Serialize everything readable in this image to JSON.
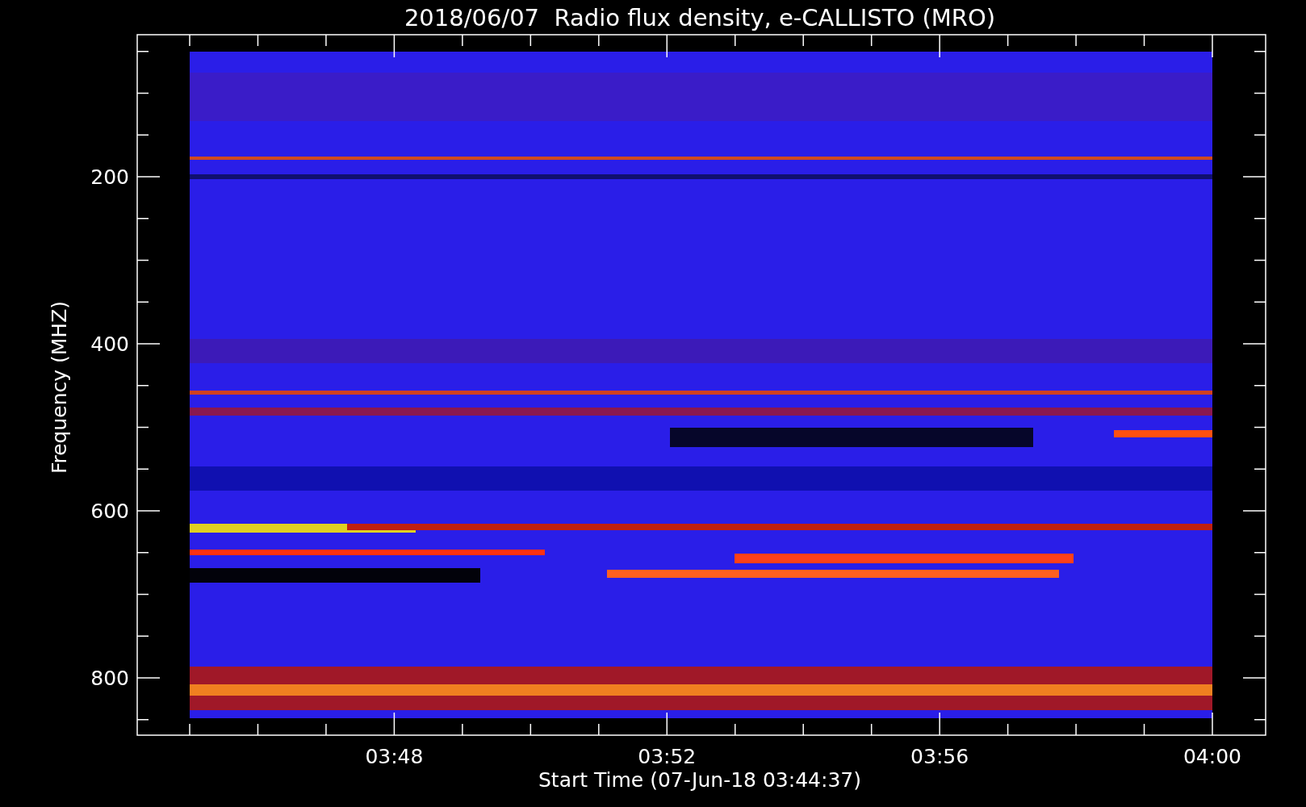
{
  "title": "2018/06/07  Radio flux density, e-CALLISTO (MRO)",
  "plot": {
    "ylabel": "Frequency (MHZ)",
    "xlabel": "Start Time (07-Jun-18 03:44:37)",
    "y_tick_labels": [
      "200",
      "400",
      "600",
      "800"
    ],
    "x_tick_labels": [
      "03:48",
      "03:52",
      "03:56",
      "04:00"
    ]
  }
}
